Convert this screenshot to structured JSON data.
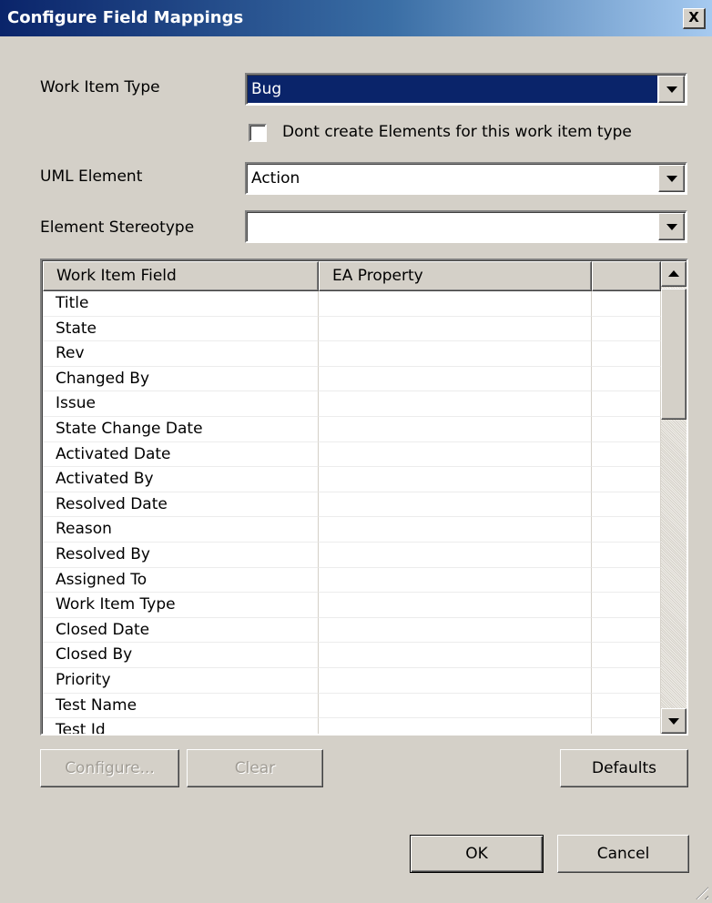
{
  "window": {
    "title": "Configure Field Mappings",
    "close_glyph": "X"
  },
  "form": {
    "work_item_type_label": "Work Item Type",
    "work_item_type_value": "Bug",
    "dont_create_label": "Dont create Elements for this work item type",
    "dont_create_checked": false,
    "uml_element_label": "UML Element",
    "uml_element_value": "Action",
    "element_stereotype_label": "Element Stereotype",
    "element_stereotype_value": ""
  },
  "grid": {
    "columns": [
      "Work Item Field",
      "EA Property",
      ""
    ],
    "rows": [
      {
        "field": "Title",
        "ea_property": ""
      },
      {
        "field": "State",
        "ea_property": ""
      },
      {
        "field": "Rev",
        "ea_property": ""
      },
      {
        "field": "Changed By",
        "ea_property": ""
      },
      {
        "field": "Issue",
        "ea_property": ""
      },
      {
        "field": "State Change Date",
        "ea_property": ""
      },
      {
        "field": "Activated Date",
        "ea_property": ""
      },
      {
        "field": "Activated By",
        "ea_property": ""
      },
      {
        "field": "Resolved Date",
        "ea_property": ""
      },
      {
        "field": "Reason",
        "ea_property": ""
      },
      {
        "field": "Resolved By",
        "ea_property": ""
      },
      {
        "field": "Assigned To",
        "ea_property": ""
      },
      {
        "field": "Work Item Type",
        "ea_property": ""
      },
      {
        "field": "Closed Date",
        "ea_property": ""
      },
      {
        "field": "Closed By",
        "ea_property": ""
      },
      {
        "field": "Priority",
        "ea_property": ""
      },
      {
        "field": "Test Name",
        "ea_property": ""
      },
      {
        "field": "Test Id",
        "ea_property": ""
      }
    ]
  },
  "buttons": {
    "configure": "Configure...",
    "clear": "Clear",
    "defaults": "Defaults",
    "ok": "OK",
    "cancel": "Cancel"
  },
  "icons": {
    "combo_arrow": "chevron-down-icon",
    "scroll_up": "arrow-up-icon",
    "scroll_down": "arrow-down-icon",
    "resize_grip": "resize-grip-icon"
  },
  "colors": {
    "title_start": "#0a246a",
    "title_end": "#a6caf0",
    "face": "#d4d0c8",
    "selection": "#0a246a"
  }
}
